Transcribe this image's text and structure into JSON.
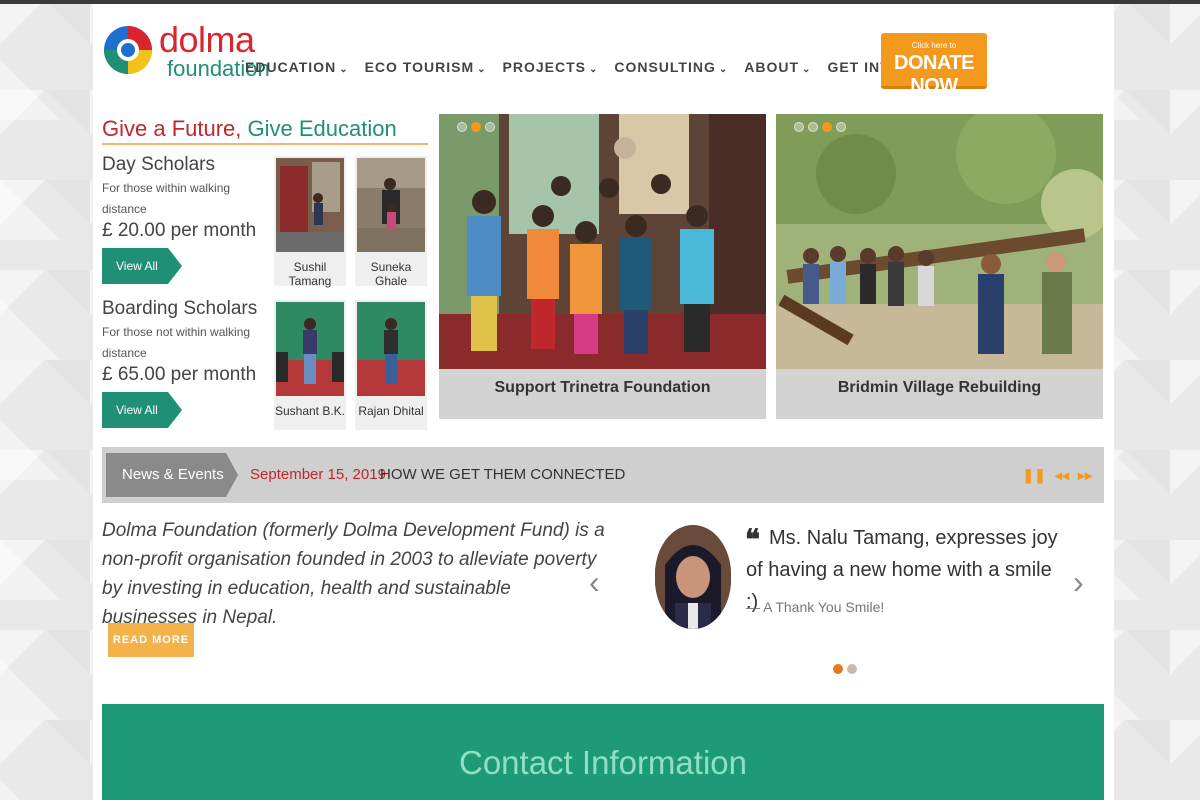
{
  "brand": {
    "name_line1": "dolma",
    "name_line2": "foundation",
    "colors": {
      "red": "#d9262e",
      "green": "#1f8f76",
      "orange": "#f39a1e"
    }
  },
  "nav": {
    "items": [
      {
        "label": "EDUCATION",
        "icon": "chevron-down-icon"
      },
      {
        "label": "ECO TOURISM",
        "icon": "chevron-down-icon"
      },
      {
        "label": "PROJECTS",
        "icon": "chevron-down-icon"
      },
      {
        "label": "CONSULTING",
        "icon": "chevron-down-icon"
      },
      {
        "label": "ABOUT",
        "icon": "chevron-down-icon"
      },
      {
        "label": "GET INVOLVED",
        "icon": "chevron-down-icon"
      }
    ]
  },
  "donate": {
    "small": "Click here to",
    "big": "DONATE NOW"
  },
  "tagline": {
    "part1": "Give a Future",
    "sep": ", ",
    "part2": "Give Education"
  },
  "scholars": {
    "day": {
      "title": "Day Scholars",
      "desc": "For those within walking distance",
      "price": "£ 20.00 per month",
      "button": "View All",
      "people": [
        "Sushil Tamang",
        "Suneka Ghale"
      ]
    },
    "boarding": {
      "title": "Boarding Scholars",
      "desc": "For those not within walking distance",
      "price": "£ 65.00 per month",
      "button": "View All",
      "people": [
        "Sushant B.K.",
        "Rajan Dhital"
      ]
    }
  },
  "slides": [
    {
      "caption": "Support Trinetra Foundation"
    },
    {
      "caption": "Bridmin Village Rebuilding"
    }
  ],
  "news": {
    "label": "News & Events",
    "date": "September 15, 2019",
    "headline": "HOW WE GET THEM CONNECTED",
    "controls": [
      "pause-icon",
      "rewind-icon",
      "forward-icon"
    ]
  },
  "about": {
    "text": "Dolma Foundation (formerly Dolma Development Fund) is a non-profit organisation founded in 2003 to alleviate poverty by investing in education, health and sustainable businesses in Nepal.",
    "button": "READ MORE"
  },
  "testimonial": {
    "quote_mark": "❝",
    "quote": "Ms. Nalu Tamang, expresses joy of having a new home with a smile :)",
    "author": "— A Thank You Smile!"
  },
  "contact": {
    "title": "Contact Information"
  }
}
